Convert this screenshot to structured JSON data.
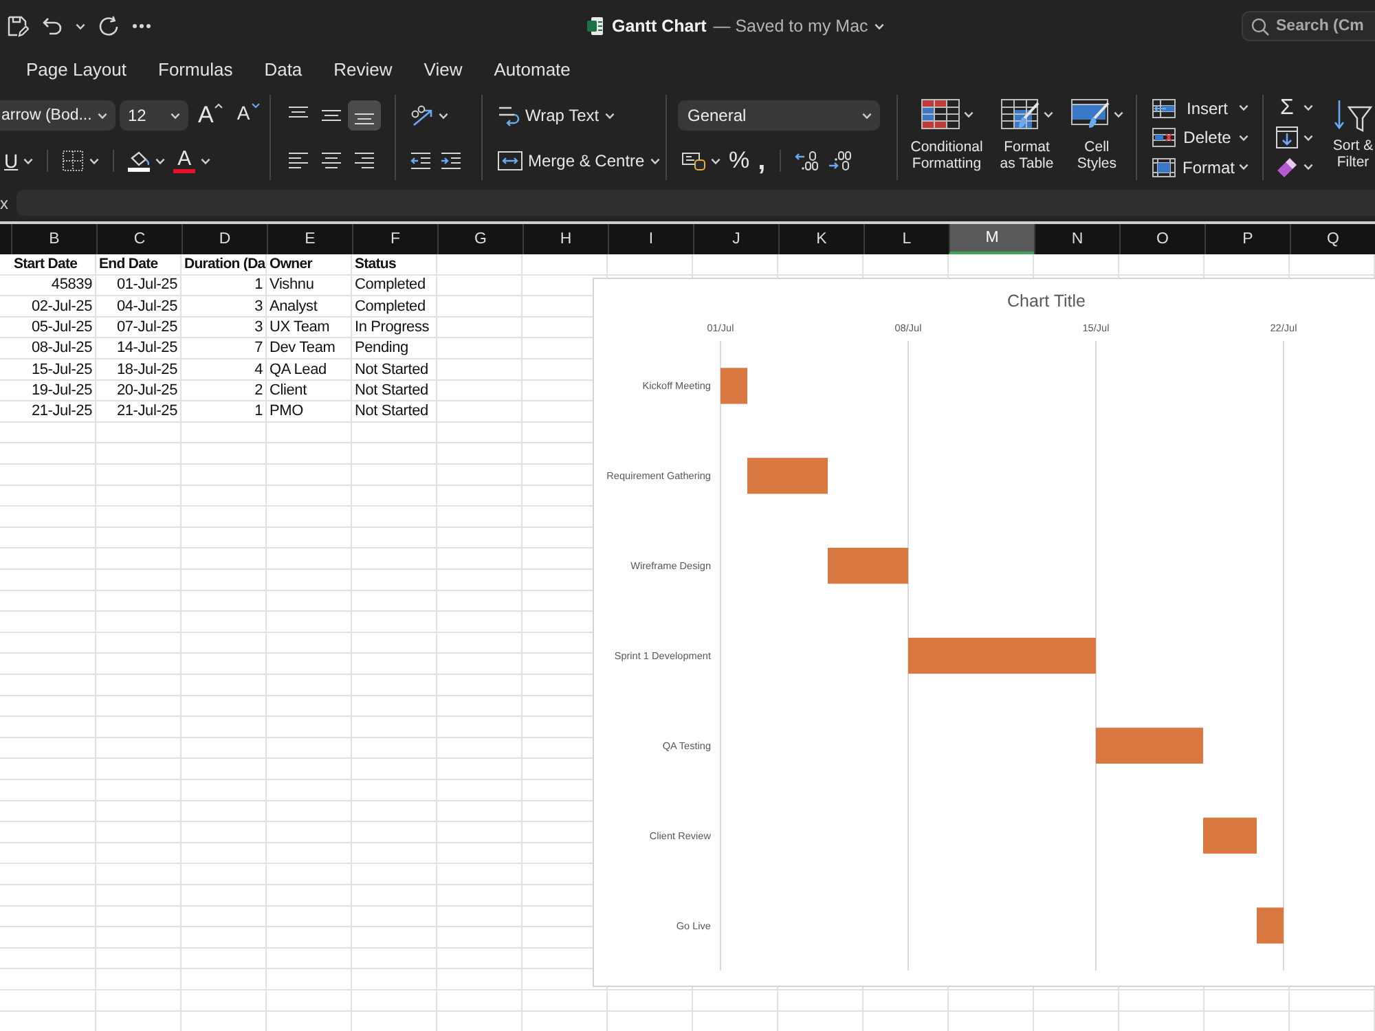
{
  "window": {
    "title": "Gantt Chart",
    "status": "— Saved to my Mac"
  },
  "search": {
    "placeholder": "Search (Cm"
  },
  "tabs": [
    {
      "label": "Page Layout",
      "selected": false
    },
    {
      "label": "Formulas",
      "selected": false
    },
    {
      "label": "Data",
      "selected": false
    },
    {
      "label": "Review",
      "selected": false
    },
    {
      "label": "View",
      "selected": false
    },
    {
      "label": "Automate",
      "selected": false
    }
  ],
  "ribbon": {
    "font_name": "arrow (Bod...",
    "font_size": "12",
    "size_buttons": [
      {
        "kind": "grow",
        "glyph": "A"
      },
      {
        "kind": "shrink",
        "glyph": "A"
      }
    ],
    "underline": "U",
    "fill_color": {
      "color": "#ffffff"
    },
    "font_color": {
      "glyph": "A",
      "color": "#e81123"
    },
    "vertical_align": [
      {
        "kind": "top",
        "selected": false
      },
      {
        "kind": "middle",
        "selected": false
      },
      {
        "kind": "bottom",
        "selected": true
      }
    ],
    "horizontal_align": [
      {
        "kind": "left",
        "selected": false
      },
      {
        "kind": "center",
        "selected": false
      },
      {
        "kind": "right",
        "selected": false
      }
    ],
    "wrap_text": "Wrap Text",
    "merge": "Merge & Centre",
    "number_format": "General",
    "percent": "%",
    "comma": ",",
    "styles": [
      {
        "kind": "conditional",
        "label": "Conditional\nFormatting"
      },
      {
        "kind": "table",
        "label": "Format\nas Table"
      },
      {
        "kind": "cell",
        "label": "Cell\nStyles"
      }
    ],
    "cells": [
      {
        "kind": "insert",
        "label": "Insert"
      },
      {
        "kind": "delete",
        "label": "Delete"
      },
      {
        "kind": "format",
        "label": "Format"
      }
    ],
    "editing": [
      {
        "kind": "autosum",
        "glyph": "Σ"
      },
      {
        "kind": "fill"
      },
      {
        "kind": "clear"
      }
    ],
    "sort_filter": "Sort &\nFilter"
  },
  "formula_bar": {
    "label": "x"
  },
  "columns": [
    {
      "label": "B",
      "selected": false
    },
    {
      "label": "C",
      "selected": false
    },
    {
      "label": "D",
      "selected": false
    },
    {
      "label": "E",
      "selected": false
    },
    {
      "label": "F",
      "selected": false
    },
    {
      "label": "G",
      "selected": false
    },
    {
      "label": "H",
      "selected": false
    },
    {
      "label": "I",
      "selected": false
    },
    {
      "label": "J",
      "selected": false
    },
    {
      "label": "K",
      "selected": false
    },
    {
      "label": "L",
      "selected": false
    },
    {
      "label": "M",
      "selected": true
    },
    {
      "label": "N",
      "selected": false
    },
    {
      "label": "O",
      "selected": false
    },
    {
      "label": "P",
      "selected": false
    },
    {
      "label": "Q",
      "selected": false
    }
  ],
  "table": {
    "header": [
      "Start Date",
      "End Date",
      "Duration (Da",
      "Owner",
      "Status"
    ],
    "rows": [
      [
        "45839",
        "01-Jul-25",
        "1",
        "Vishnu",
        "Completed"
      ],
      [
        "02-Jul-25",
        "04-Jul-25",
        "3",
        "Analyst",
        "Completed"
      ],
      [
        "05-Jul-25",
        "07-Jul-25",
        "3",
        "UX Team",
        "In Progress"
      ],
      [
        "08-Jul-25",
        "14-Jul-25",
        "7",
        "Dev Team",
        "Pending"
      ],
      [
        "15-Jul-25",
        "18-Jul-25",
        "4",
        "QA Lead",
        "Not Started"
      ],
      [
        "19-Jul-25",
        "20-Jul-25",
        "2",
        "Client",
        "Not Started"
      ],
      [
        "21-Jul-25",
        "21-Jul-25",
        "1",
        "PMO",
        "Not Started"
      ]
    ]
  },
  "chart": {
    "title": "Chart Title",
    "date_labels": [
      "01/Jul",
      "08/Jul",
      "15/Jul",
      "22/Jul"
    ],
    "tasks": [
      "Kickoff Meeting",
      "Requirement Gathering",
      "Wireframe Design",
      "Sprint 1 Development",
      "QA Testing",
      "Client Review",
      "Go Live"
    ]
  }
}
